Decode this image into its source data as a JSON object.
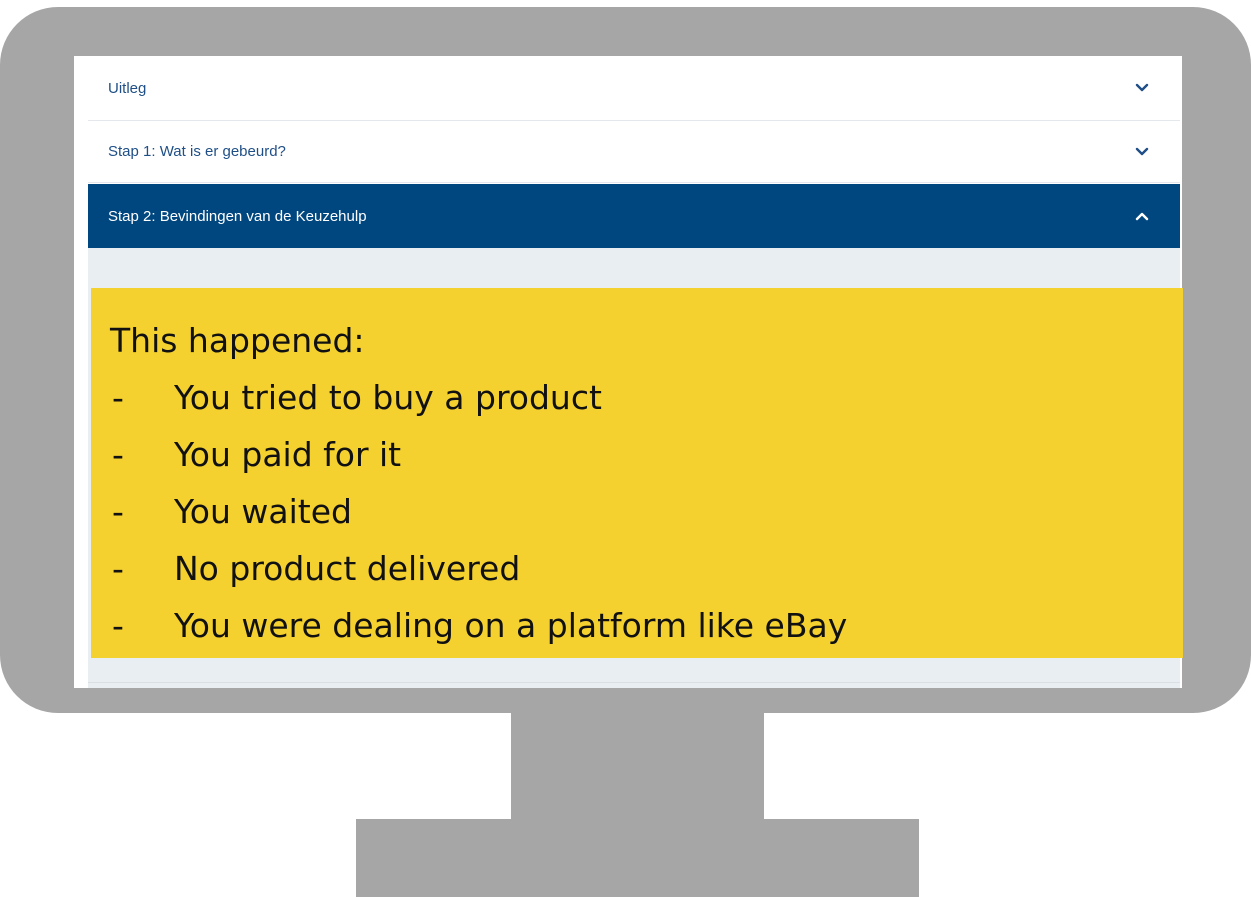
{
  "accordion": {
    "items": [
      {
        "label": "Uitleg",
        "expanded": false,
        "chevron": "chevron-down-icon"
      },
      {
        "label": "Stap 1: Wat is er gebeurd?",
        "expanded": false,
        "chevron": "chevron-down-icon"
      },
      {
        "label": "Stap 2: Bevindingen van de Keuzehulp",
        "expanded": true,
        "chevron": "chevron-up-icon"
      }
    ],
    "active_color": "#00467f",
    "label_color": "#1f4f86"
  },
  "callout": {
    "heading": "This happened:",
    "bullet": "-",
    "items": [
      "You tried to buy a product",
      "You paid for it",
      "You waited",
      "No product delivered",
      "You were dealing on a platform like eBay"
    ],
    "background": "#f5d130"
  },
  "monitor": {
    "frame_color": "#a6a6a6"
  }
}
